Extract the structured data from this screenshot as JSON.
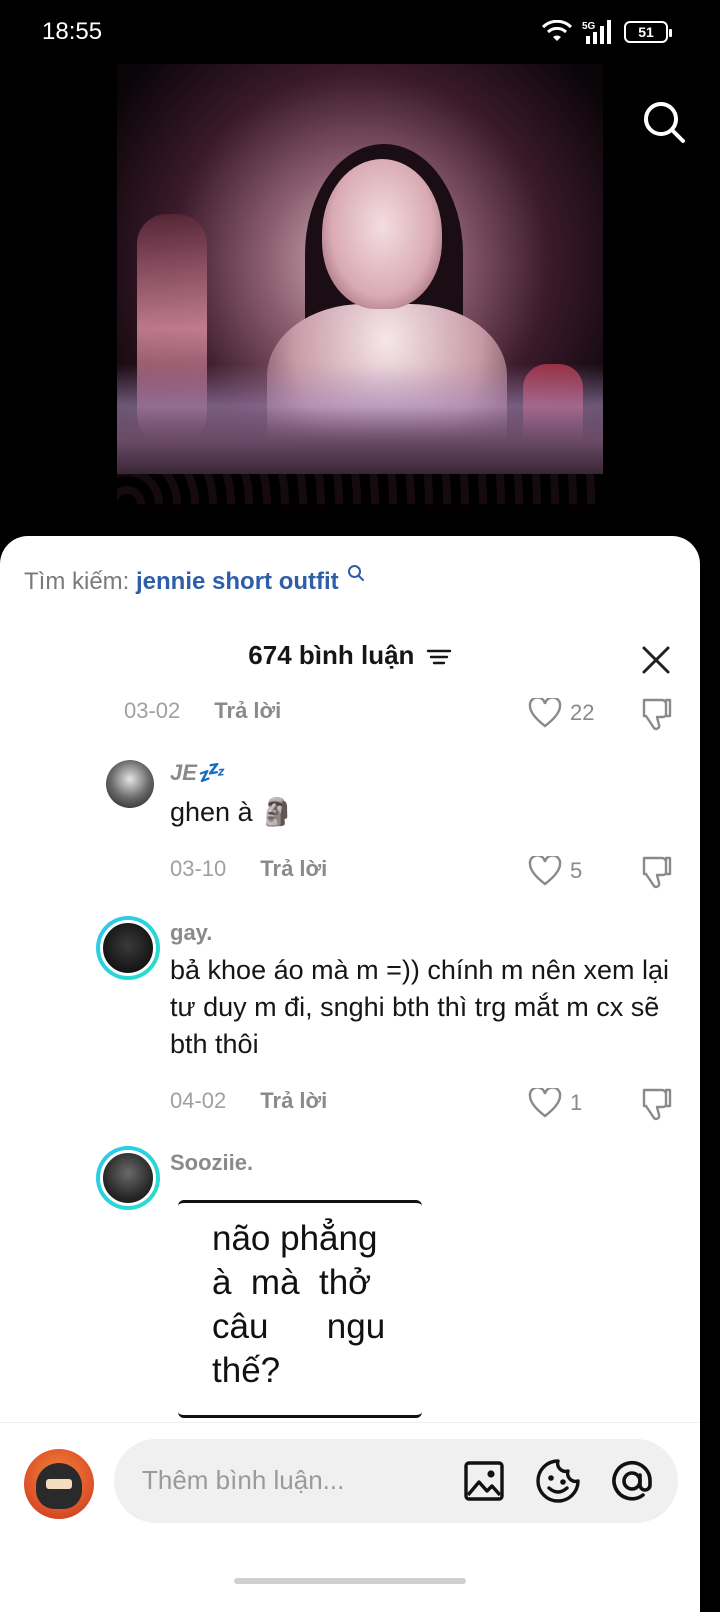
{
  "status_bar": {
    "time": "18:55",
    "network": "5G",
    "battery": "51"
  },
  "search_suggestion": {
    "prefix": "Tìm kiếm:",
    "query": "jennie short outfit"
  },
  "comments_header": {
    "title": "674 bình luận"
  },
  "input": {
    "placeholder": "Thêm bình luận..."
  },
  "reply_label": "Trả lời",
  "comments": [
    {
      "date": "03-02",
      "likes": "22"
    },
    {
      "username": "JE💤",
      "text": "ghen à 🗿",
      "date": "03-10",
      "likes": "5"
    },
    {
      "username": "gay.",
      "text": "bả khoe áo mà m =)) chính m nên xem lại tư duy m đi, snghi bth thì trg mắt m cx sẽ bth thôi",
      "date": "04-02",
      "likes": "1"
    },
    {
      "username": "Sooziie.",
      "sticker_text": "não phẳng\nà  mà  thở\ncâu      ngu\nthế?"
    }
  ],
  "colors": {
    "link": "#2f5ea8",
    "avatar_ring": "#2ec6f0"
  }
}
